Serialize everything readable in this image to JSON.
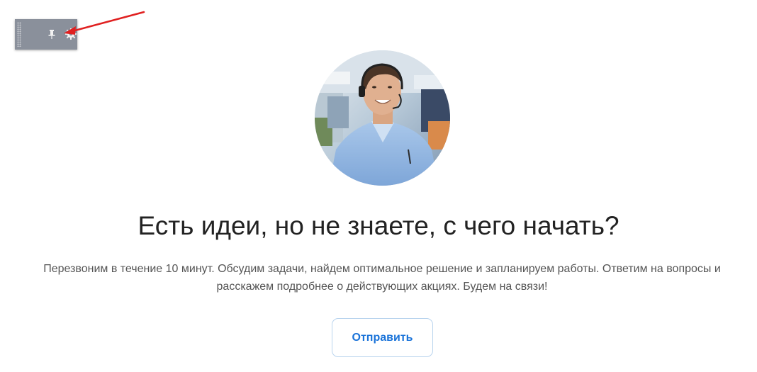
{
  "toolbar": {
    "icons": [
      "grip-icon",
      "pin-icon",
      "gear-icon",
      "caret-down-icon"
    ]
  },
  "annotation": {
    "arrow_color": "#e02020"
  },
  "hero": {
    "avatar_alt": "",
    "heading": "Есть идеи, но не знаете, с чего начать?",
    "description": "Перезвоним в течение 10 минут. Обсудим задачи, найдем оптимальное решение и запланируем работы. Ответим на вопросы и расскажем подробнее о действующих акциях. Будем на связи!",
    "button_label": "Отправить"
  },
  "colors": {
    "toolbar_bg": "#8a909b",
    "heading": "#222222",
    "description": "#555555",
    "button_text": "#1a73d9",
    "button_border": "#b9d4ee"
  }
}
